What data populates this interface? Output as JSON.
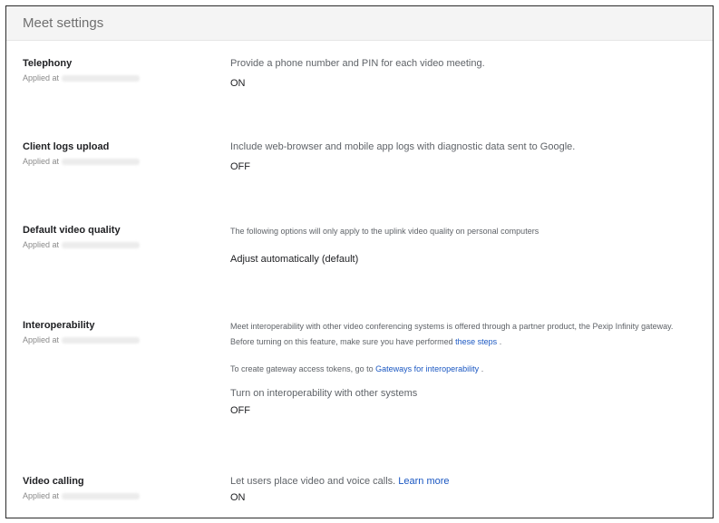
{
  "header": {
    "title": "Meet settings"
  },
  "applied_prefix": "Applied at",
  "telephony": {
    "title": "Telephony",
    "description": "Provide a phone number and PIN for each video meeting.",
    "value": "ON"
  },
  "client_logs": {
    "title": "Client logs upload",
    "description": "Include web-browser and mobile app logs with diagnostic data sent to Google.",
    "value": "OFF"
  },
  "video_quality": {
    "title": "Default video quality",
    "note": "The following options will only apply to the uplink video quality on personal computers",
    "value": "Adjust automatically (default)"
  },
  "interop": {
    "title": "Interoperability",
    "line1": "Meet interoperability with other video conferencing systems is offered through a partner product, the Pexip Infinity gateway.",
    "line2_prefix": "Before turning on this feature, make sure you have performed",
    "line2_link": "these steps",
    "line2_suffix": ".",
    "tokens_prefix": "To create gateway access tokens, go to",
    "tokens_link": "Gateways for interoperability",
    "tokens_suffix": ".",
    "toggle_label": "Turn on interoperability with other systems",
    "value": "OFF"
  },
  "video_calling": {
    "title": "Video calling",
    "description": "Let users place video and voice calls.",
    "learn_more": "Learn more",
    "value": "ON"
  }
}
